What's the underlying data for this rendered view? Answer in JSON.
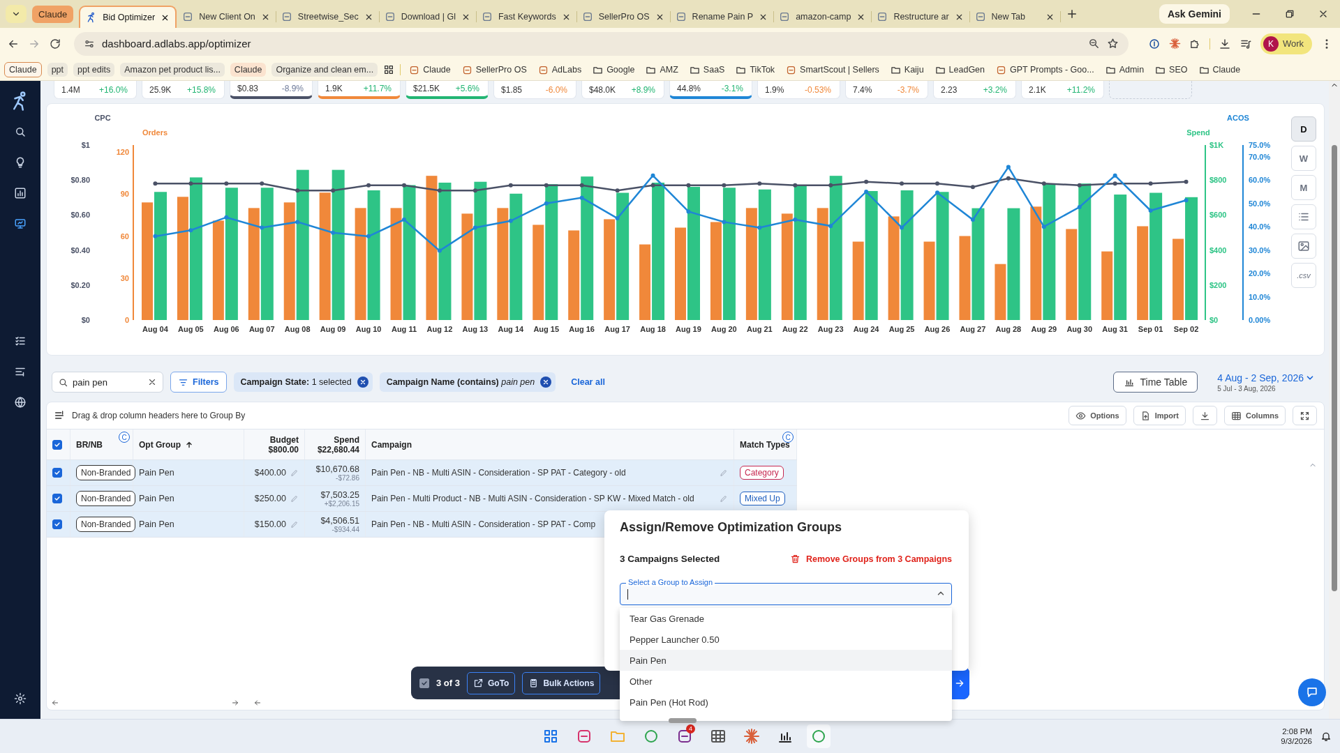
{
  "browser": {
    "tab_group": "Claude",
    "tabs": [
      {
        "label": "Bid Optimizer",
        "selected": true
      },
      {
        "label": "New Client On",
        "selected": false
      },
      {
        "label": "Streetwise_Sec",
        "selected": false
      },
      {
        "label": "Download | Gl",
        "selected": false
      },
      {
        "label": "Fast Keywords",
        "selected": false
      },
      {
        "label": "SellerPro OS",
        "selected": false
      },
      {
        "label": "Rename Pain P",
        "selected": false
      },
      {
        "label": "amazon-camp",
        "selected": false
      },
      {
        "label": "Restructure ar",
        "selected": false
      },
      {
        "label": "New Tab",
        "selected": false
      }
    ],
    "ask_gemini": "Ask Gemini",
    "url": "dashboard.adlabs.app/optimizer",
    "profile": {
      "initial": "K",
      "label": "Work"
    },
    "bookmarks": [
      {
        "label": "Claude",
        "kind": "group-outlined"
      },
      {
        "label": "ppt",
        "kind": "group"
      },
      {
        "label": "ppt edits",
        "kind": "group"
      },
      {
        "label": "Amazon pet product lis...",
        "kind": "group"
      },
      {
        "label": "Claude",
        "kind": "group-accent"
      },
      {
        "label": "Organize and clean em...",
        "kind": "group"
      },
      {
        "label": "Claude",
        "kind": "site"
      },
      {
        "label": "SellerPro OS",
        "kind": "site"
      },
      {
        "label": "AdLabs",
        "kind": "site"
      },
      {
        "label": "Google",
        "kind": "folder"
      },
      {
        "label": "AMZ",
        "kind": "folder"
      },
      {
        "label": "SaaS",
        "kind": "folder"
      },
      {
        "label": "TikTok",
        "kind": "folder"
      },
      {
        "label": "SmartScout | Sellers",
        "kind": "site"
      },
      {
        "label": "Kaiju",
        "kind": "folder"
      },
      {
        "label": "LeadGen",
        "kind": "folder"
      },
      {
        "label": "GPT Prompts - Goo...",
        "kind": "site"
      },
      {
        "label": "Admin",
        "kind": "folder"
      },
      {
        "label": "SEO",
        "kind": "folder"
      },
      {
        "label": "Claude",
        "kind": "folder"
      }
    ]
  },
  "sidebar": {
    "items": [
      {
        "selected": false
      },
      {
        "selected": false
      },
      {
        "selected": false
      },
      {
        "selected": true
      },
      {
        "selected": false
      },
      {
        "selected": false
      },
      {
        "selected": false
      },
      {
        "selected": false
      }
    ]
  },
  "kpis": [
    {
      "value": "1.4M",
      "change": {
        "text": "+16.0%",
        "color": "#22b573"
      }
    },
    {
      "value": "25.9K",
      "change": {
        "text": "+15.8%",
        "color": "#22b573"
      }
    },
    {
      "value": "$0.83",
      "change": {
        "text": "-8.9%",
        "color": "#6d7a99"
      },
      "color": "#4a5166"
    },
    {
      "value": "1.9K",
      "change": {
        "text": "+11.7%",
        "color": "#22b573"
      },
      "color": "#f0883a"
    },
    {
      "value": "$21.5K",
      "change": {
        "text": "+5.6%",
        "color": "#22b573"
      },
      "color": "#22b573"
    },
    {
      "value": "$1.85",
      "change": {
        "text": "-6.0%",
        "color": "#f0883a"
      }
    },
    {
      "value": "$48.0K",
      "change": {
        "text": "+8.9%",
        "color": "#22b573"
      }
    },
    {
      "value": "44.8%",
      "change": {
        "text": "-3.1%",
        "color": "#22b573"
      },
      "color": "#1f86d6"
    },
    {
      "value": "1.9%",
      "change": {
        "text": "-0.53%",
        "color": "#f0883a"
      }
    },
    {
      "value": "7.4%",
      "change": {
        "text": "-3.7%",
        "color": "#f0883a"
      }
    },
    {
      "value": "2.23",
      "change": {
        "text": "+3.2%",
        "color": "#22b573"
      }
    },
    {
      "value": "2.1K",
      "change": {
        "text": "+11.2%",
        "color": "#22b573"
      }
    }
  ],
  "chart": {
    "ranges": [
      {
        "label": "D",
        "selected": true
      },
      {
        "label": "W",
        "selected": false
      },
      {
        "label": "M",
        "selected": false
      }
    ],
    "csv_label": ".csv",
    "bar_chart": {
      "chart_data": {
        "type": "bar",
        "categories": [
          "Aug 04",
          "Aug 05",
          "Aug 06",
          "Aug 07",
          "Aug 08",
          "Aug 09",
          "Aug 10",
          "Aug 11",
          "Aug 12",
          "Aug 13",
          "Aug 14",
          "Aug 15",
          "Aug 16",
          "Aug 17",
          "Aug 18",
          "Aug 19",
          "Aug 20",
          "Aug 21",
          "Aug 22",
          "Aug 23",
          "Aug 24",
          "Aug 25",
          "Aug 26",
          "Aug 27",
          "Aug 28",
          "Aug 29",
          "Aug 30",
          "Aug 31",
          "Sep 01",
          "Sep 02"
        ],
        "ylim": [
          0,
          125
        ],
        "yticks": [
          0,
          30,
          60,
          90,
          120
        ],
        "y2lim": [
          0,
          1000
        ],
        "y2ticks": [
          {
            "value": 0,
            "label": "$0"
          },
          {
            "value": 200,
            "label": "$200"
          },
          {
            "value": 400,
            "label": "$400"
          },
          {
            "value": 600,
            "label": "$600"
          },
          {
            "value": 800,
            "label": "$800"
          },
          {
            "value": 1000,
            "label": "$1K"
          }
        ],
        "series": [
          {
            "name": "Orders",
            "color": "#f0883a",
            "values": [
              84,
              88,
              71,
              80,
              84,
              91,
              80,
              80,
              103,
              76,
              80,
              68,
              64,
              72,
              54,
              66,
              70,
              80,
              76,
              80,
              56,
              74,
              56,
              60,
              40,
              81,
              65,
              49,
              67,
              58
            ]
          },
          {
            "name": "Spend",
            "color": "#2ec486",
            "axis": "y2",
            "values": [
              732,
              815,
              756,
              756,
              858,
              858,
              741,
              771,
              785,
              790,
              722,
              776,
              820,
              727,
              785,
              761,
              756,
              746,
              771,
              824,
              737,
              741,
              732,
              639,
              639,
              780,
              780,
              717,
              727,
              702
            ]
          }
        ]
      }
    },
    "line_chart": {
      "chart_data": {
        "type": "line",
        "ylim": [
          0,
          1
        ],
        "yticks": [
          {
            "value": 0,
            "label": "$0"
          },
          {
            "value": 0.2,
            "label": "$0.20"
          },
          {
            "value": 0.4,
            "label": "$0.40"
          },
          {
            "value": 0.6,
            "label": "$0.60"
          },
          {
            "value": 0.8,
            "label": "$0.80"
          },
          {
            "value": 1,
            "label": "$1"
          }
        ],
        "y2lim": [
          0,
          75
        ],
        "y2ticks": [
          {
            "value": 0,
            "label": "0.00%"
          },
          {
            "value": 10,
            "label": "10.0%"
          },
          {
            "value": 20,
            "label": "20.0%"
          },
          {
            "value": 30,
            "label": "30.0%"
          },
          {
            "value": 40,
            "label": "40.0%"
          },
          {
            "value": 50,
            "label": "50.0%"
          },
          {
            "value": 60,
            "label": "60.0%"
          },
          {
            "value": 70,
            "label": "70.0%"
          },
          {
            "value": 75,
            "label": "75.0%"
          }
        ],
        "series": [
          {
            "name": "CPC",
            "color": "#4a5166",
            "marker": "circle",
            "values": [
              0.78,
              0.78,
              0.78,
              0.78,
              0.74,
              0.74,
              0.77,
              0.77,
              0.74,
              0.74,
              0.77,
              0.77,
              0.77,
              0.74,
              0.77,
              0.77,
              0.77,
              0.78,
              0.77,
              0.77,
              0.79,
              0.78,
              0.78,
              0.76,
              0.81,
              0.78,
              0.77,
              0.78,
              0.78,
              0.79
            ]
          },
          {
            "name": "ACOS",
            "color": "#1f86d6",
            "axis": "y2",
            "marker": "circle",
            "values": [
              35.9,
              38.5,
              44,
              39.6,
              42,
              37.4,
              35.9,
              43,
              29.7,
              39.6,
              42.5,
              50,
              52.4,
              43.6,
              61.9,
              46.5,
              42,
              39.6,
              43,
              40.3,
              55,
              39.6,
              54.6,
              43,
              65.6,
              40,
              48.4,
              61.9,
              46.9,
              51.3
            ]
          }
        ]
      }
    }
  },
  "filters": {
    "search": "pain pen",
    "filters_label": "Filters",
    "chips": [
      "**Campaign State:** 1 selected",
      "**Campaign Name (contains)** *pain pen*"
    ],
    "clear_all": "Clear all",
    "time_table": "Time Table",
    "date_range": "4 Aug - 2 Sep, 2026",
    "compare_range": "5 Jul - 3 Aug, 2026"
  },
  "grid": {
    "group_by_hint": "Drag & drop column headers here to Group By",
    "options": "Options",
    "import": "Import",
    "columns_button": "Columns",
    "select_all": true,
    "columns": [
      {
        "label": "BR/NB",
        "badge": "C"
      },
      {
        "label": "Opt Group",
        "sorted": true
      },
      {
        "label": "Budget",
        "total": "$800.00"
      },
      {
        "label": "Spend",
        "total": "$22,680.44"
      },
      {
        "label": "Campaign"
      },
      {
        "label": "Match Types",
        "badge": "C"
      }
    ],
    "rows": [
      {
        "selected": true,
        "br_nb": "Non-Branded",
        "opt_group": "Pain Pen",
        "budget": "$400.00",
        "spend": "$10,670.68",
        "spend_change": "-$72.86",
        "campaign": "Pain Pen - NB - Multi ASIN - Consideration - SP PAT - Category - old",
        "match_type": {
          "label": "Category",
          "color": "#c62850"
        }
      },
      {
        "selected": true,
        "br_nb": "Non-Branded",
        "opt_group": "Pain Pen",
        "budget": "$250.00",
        "spend": "$7,503.25",
        "spend_change": "+$2,206.15",
        "campaign": "Pain Pen - Multi Product - NB - Multi ASIN - Consideration - SP KW - Mixed Match - old",
        "match_type": {
          "label": "Mixed Up",
          "color": "#1f5fbf"
        }
      },
      {
        "selected": true,
        "br_nb": "Non-Branded",
        "opt_group": "Pain Pen",
        "budget": "$150.00",
        "spend": "$4,506.51",
        "spend_change": "-$934.44",
        "campaign": "Pain Pen - NB - Multi ASIN - Consideration - SP PAT - Comp"
      }
    ]
  },
  "dialog": {
    "title": "Assign/Remove Optimization Groups",
    "selected_label": "3 Campaigns Selected",
    "remove_label": "Remove Groups from 3 Campaigns",
    "field_label": "Select a Group to Assign",
    "options": [
      {
        "label": "Tear Gas Grenade",
        "highlighted": false
      },
      {
        "label": "Pepper Launcher 0.50",
        "highlighted": false
      },
      {
        "label": "Pain Pen",
        "highlighted": true
      },
      {
        "label": "Other",
        "highlighted": false
      },
      {
        "label": "Pain Pen (Hot Rod)",
        "highlighted": false
      }
    ]
  },
  "action_bar": {
    "checked": true,
    "count": "3 of 3",
    "goto": "GoTo",
    "bulk_actions": "Bulk Actions"
  },
  "taskbar": {
    "badge": "4",
    "time": "2:08 PM",
    "date": "9/3/2026"
  }
}
